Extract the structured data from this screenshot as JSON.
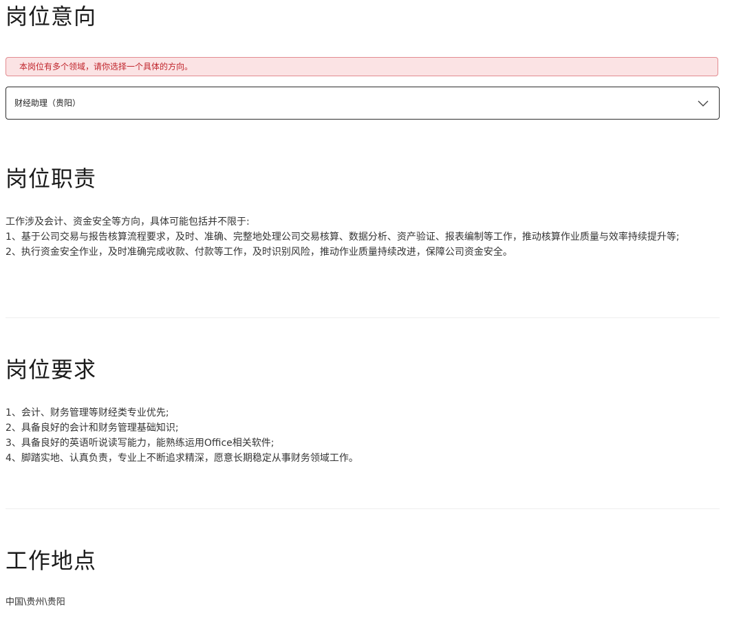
{
  "intent": {
    "title": "岗位意向",
    "alert": "本岗位有多个领域，请你选择一个具体的方向。",
    "select_value": "财经助理（贵阳）",
    "select_icon": "chevron-down-icon"
  },
  "duties": {
    "title": "岗位职责",
    "lines": [
      "工作涉及会计、资金安全等方向，具体可能包括并不限于:",
      "1、基于公司交易与报告核算流程要求，及时、准确、完整地处理公司交易核算、数据分析、资产验证、报表编制等工作，推动核算作业质量与效率持续提升等;",
      "2、执行资金安全作业，及时准确完成收款、付款等工作，及时识别风险，推动作业质量持续改进，保障公司资金安全。"
    ]
  },
  "requirements": {
    "title": "岗位要求",
    "lines": [
      "1、会计、财务管理等财经类专业优先;",
      "2、具备良好的会计和财务管理基础知识;",
      "3、具备良好的英语听说读写能力，能熟练运用Office相关软件;",
      "4、脚踏实地、认真负责，专业上不断追求精深，愿意长期稳定从事财务领域工作。"
    ]
  },
  "location": {
    "title": "工作地点",
    "value": "中国\\贵州\\贵阳"
  },
  "colors": {
    "alert_bg": "#fbe3e4",
    "alert_border": "#e28a8f",
    "alert_text": "#c0252c",
    "select_border": "#2b2b2b"
  }
}
